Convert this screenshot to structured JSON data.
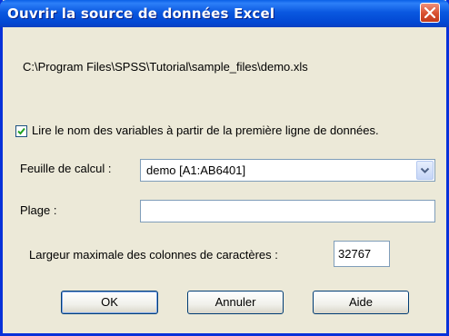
{
  "window": {
    "title": "Ouvrir la source de données Excel"
  },
  "file_path": "C:\\Program Files\\SPSS\\Tutorial\\sample_files\\demo.xls",
  "read_names": {
    "label": "Lire le nom des variables à partir de la première ligne de données.",
    "checked": true
  },
  "worksheet": {
    "label": "Feuille de calcul :",
    "value": "demo  [A1:AB6401]"
  },
  "range": {
    "label": "Plage :",
    "value": ""
  },
  "max_width": {
    "label": "Largeur maximale des colonnes de caractères :",
    "value": "32767"
  },
  "buttons": {
    "ok": "OK",
    "cancel": "Annuler",
    "help": "Aide"
  },
  "colors": {
    "titlebar": "#0a58e0",
    "background": "#ece9d8",
    "close": "#d8502f",
    "border": "#7f9db9"
  }
}
